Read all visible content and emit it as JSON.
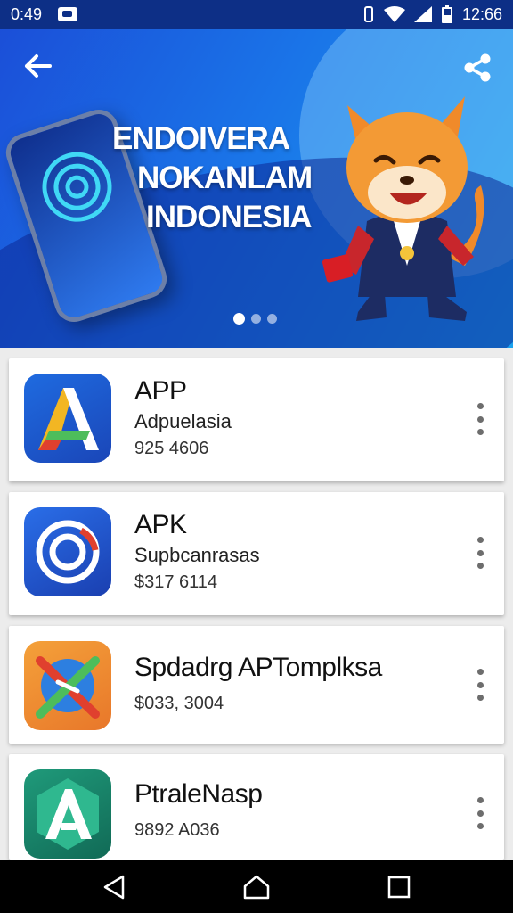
{
  "status_bar": {
    "time_left": "0:49",
    "time_right": "12:66"
  },
  "hero": {
    "lines": [
      "ENDOIVERA",
      "NOKANLAM",
      "INDONESIA"
    ],
    "slides": 3,
    "active_slide": 1
  },
  "apps": [
    {
      "title": "APP",
      "subtitle": "Adpuelasia",
      "price": "925 4606",
      "icon": "letter-a-colorful-icon"
    },
    {
      "title": "APK",
      "subtitle": "Supbcanrasas",
      "price": "$317 6114",
      "icon": "target-ring-icon"
    },
    {
      "title": "Spdadrg APTomplksa",
      "subtitle": "",
      "price": "$033, 3004",
      "icon": "crossed-tools-icon"
    },
    {
      "title": "PtraleNasp",
      "subtitle": "",
      "price": "9892 A036",
      "icon": "letter-a-shield-icon"
    }
  ],
  "colors": {
    "status_bar": "#0d2f86",
    "hero_blue": "#1a74e8",
    "card_bg": "#ffffff",
    "page_bg": "#ececec"
  }
}
